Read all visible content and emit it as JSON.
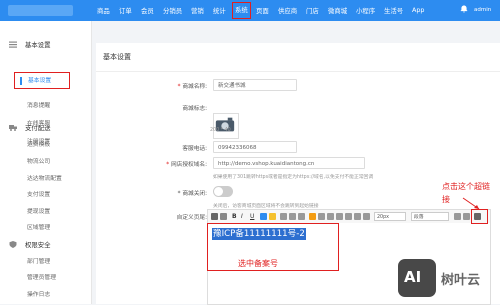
{
  "nav": {
    "items": [
      {
        "label": "商品"
      },
      {
        "label": "订单"
      },
      {
        "label": "会员"
      },
      {
        "label": "分销员"
      },
      {
        "label": "营销"
      },
      {
        "label": "统计"
      },
      {
        "label": "系统"
      },
      {
        "label": "页面"
      },
      {
        "label": "供应商"
      },
      {
        "label": "门店"
      },
      {
        "label": "微商城"
      },
      {
        "label": "小程序"
      },
      {
        "label": "生活号"
      },
      {
        "label": "App"
      }
    ],
    "active_index": 6,
    "user": "admin"
  },
  "sidebar": {
    "sections": [
      {
        "title": "基本设置",
        "items": [
          "基本设置",
          "消息提醒",
          "在线客服",
          "注册设置"
        ]
      },
      {
        "title": "支付配送",
        "items": [
          "运费模板",
          "物流公司",
          "达达物流配置",
          "支付设置",
          "提现设置",
          "区域管理"
        ]
      },
      {
        "title": "权限安全",
        "items": [
          "部门管理",
          "管理员管理",
          "操作日志"
        ]
      }
    ]
  },
  "main": {
    "page_title": "基本设置",
    "form": {
      "store_name_label": "商城名称:",
      "store_name_value": "新交通书城",
      "logo_label": "商城标志:",
      "logo_hint": "200 * 40",
      "phone_label": "客服电话:",
      "phone_value": "09942336068",
      "domain_label": "网店授权域名:",
      "domain_value": "http://demo.vshop.kuaidiantong.cn",
      "domain_hint": "如果使用了301跳转https或者是指定为https://域名,以免支付不能正常回调",
      "close_label": "* 商城关闭:",
      "close_hint": "关闭后，访客商城页面区域将不会跳转到起始链接",
      "footer_label": "自定义页尾:",
      "editor_font": "20px",
      "editor_align": "段落",
      "editor_content": "豫ICP备11111111号-2"
    }
  },
  "annotations": {
    "select_text": "选中备案号",
    "click_link_line1": "点击这个超链",
    "click_link_line2": "接"
  },
  "watermark": {
    "logo_text": "AI",
    "brand": "树叶云"
  },
  "colors": {
    "accent": "#2d8cf0",
    "highlight": "#e02020"
  }
}
